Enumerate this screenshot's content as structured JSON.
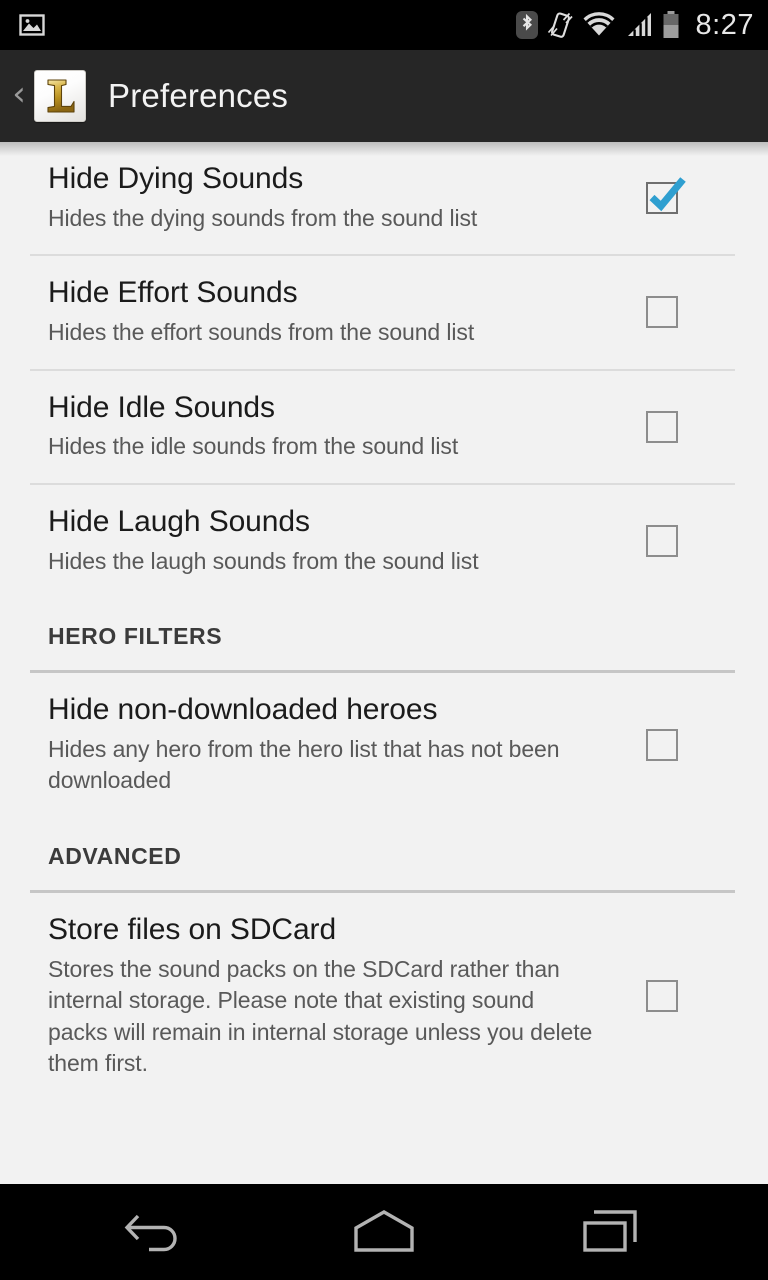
{
  "status_bar": {
    "time": "8:27",
    "icons": [
      {
        "name": "image-notification-icon",
        "side": "left"
      },
      {
        "name": "bluetooth-icon",
        "side": "right"
      },
      {
        "name": "vibrate-mode-icon",
        "side": "right"
      },
      {
        "name": "wifi-signal-icon",
        "side": "right"
      },
      {
        "name": "cellular-signal-icon",
        "side": "right"
      },
      {
        "name": "battery-icon",
        "side": "right"
      }
    ]
  },
  "action_bar": {
    "back_label": "‹",
    "app_icon_letter": "L",
    "title": "Preferences"
  },
  "colors": {
    "status_bar_bg": "#000000",
    "action_bar_bg": "#262626",
    "content_bg": "#f2f2f2",
    "title_text": "#1b1b1b",
    "summary_text": "#595959",
    "section_text": "#3b3b3b",
    "checkbox_border": "#8d8d8d",
    "checkmark_accent": "#2f9fd0",
    "divider": "#dcdcdc",
    "section_divider": "#c6c6c6",
    "nav_icon": "#b3b3b3",
    "app_icon_gold": "#c9a227"
  },
  "preferences": [
    {
      "name": "hide-dying-sounds",
      "title": "Hide Dying Sounds",
      "summary": "Hides the dying sounds from the sound list",
      "checked": true
    },
    {
      "name": "hide-effort-sounds",
      "title": "Hide Effort Sounds",
      "summary": "Hides the effort sounds from the sound list",
      "checked": false
    },
    {
      "name": "hide-idle-sounds",
      "title": "Hide Idle Sounds",
      "summary": "Hides the idle sounds from the sound list",
      "checked": false
    },
    {
      "name": "hide-laugh-sounds",
      "title": "Hide Laugh Sounds",
      "summary": "Hides the laugh sounds from the sound list",
      "checked": false
    }
  ],
  "sections": [
    {
      "name": "hero-filters",
      "header": "HERO FILTERS",
      "items": [
        {
          "name": "hide-non-downloaded-heroes",
          "title": "Hide non-downloaded heroes",
          "summary": "Hides any hero from the hero list that has not been downloaded",
          "checked": false
        }
      ]
    },
    {
      "name": "advanced",
      "header": "ADVANCED",
      "items": [
        {
          "name": "store-files-on-sdcard",
          "title": "Store files on SDCard",
          "summary": "Stores the sound packs on the SDCard rather than internal storage. Please note that existing sound packs will remain in internal storage unless you delete them first.",
          "checked": false
        }
      ]
    }
  ],
  "nav_bar": {
    "buttons": [
      {
        "name": "nav-back-button",
        "label": "Back"
      },
      {
        "name": "nav-home-button",
        "label": "Home"
      },
      {
        "name": "nav-recents-button",
        "label": "Recents"
      }
    ]
  }
}
